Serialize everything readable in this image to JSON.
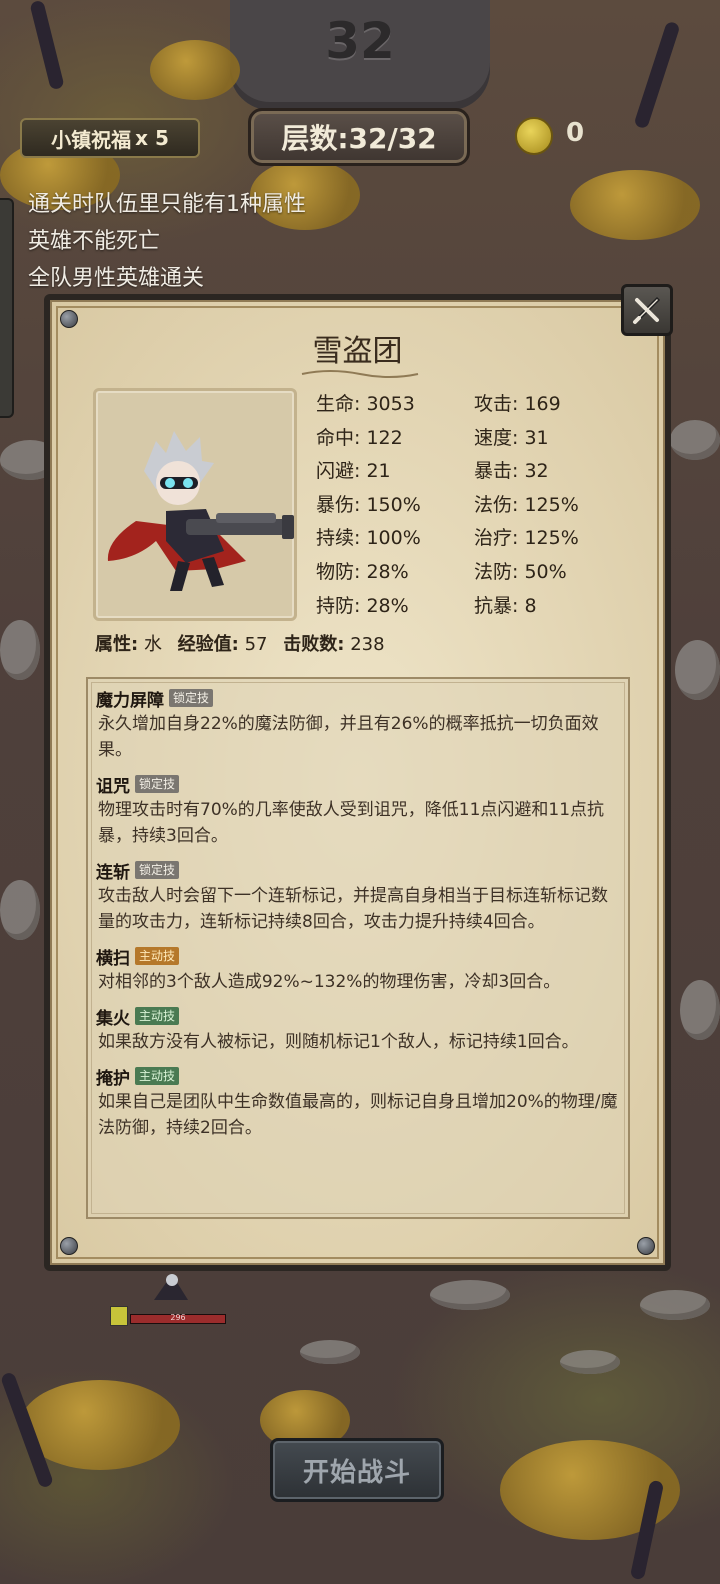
{
  "hud": {
    "wave_number": "32",
    "blessing_label": "小镇祝福",
    "blessing_count": "x 5",
    "floor_label": "层数:32/32",
    "coins": "0"
  },
  "objectives": [
    "通关时队伍里只能有1种属性",
    "英雄不能死亡",
    "全队男性英雄通关"
  ],
  "hero": {
    "name": "雪盗团",
    "stats": [
      "生命: 3053",
      "攻击: 169",
      "命中: 122",
      "速度: 31",
      "闪避: 21",
      "暴击: 32",
      "暴伤: 150%",
      "法伤: 125%",
      "持续: 100%",
      "治疗: 125%",
      "物防: 28%",
      "法防: 50%",
      "持防: 28%",
      "抗暴: 8"
    ],
    "attribute_label": "属性:",
    "attribute_value": "水",
    "exp_label": "经验值:",
    "exp_value": "57",
    "kills_label": "击败数:",
    "kills_value": "238"
  },
  "skills": [
    {
      "name": "魔力屏障",
      "tag": "锁定技",
      "tag_type": "locked",
      "desc": "永久增加自身22%的魔法防御，并且有26%的概率抵抗一切负面效果。"
    },
    {
      "name": "诅咒",
      "tag": "锁定技",
      "tag_type": "locked",
      "desc": "物理攻击时有70%的几率使敌人受到诅咒，降低11点闪避和11点抗暴，持续3回合。"
    },
    {
      "name": "连斩",
      "tag": "锁定技",
      "tag_type": "locked",
      "desc": "攻击敌人时会留下一个连斩标记，并提高自身相当于目标连斩标记数量的攻击力，连斩标记持续8回合，攻击力提升持续4回合。"
    },
    {
      "name": "横扫",
      "tag": "主动技",
      "tag_type": "active-o",
      "desc": "对相邻的3个敌人造成92%~132%的物理伤害，冷却3回合。"
    },
    {
      "name": "集火",
      "tag": "主动技",
      "tag_type": "active-g",
      "desc": "如果敌方没有人被标记，则随机标记1个敌人，标记持续1回合。"
    },
    {
      "name": "掩护",
      "tag": "主动技",
      "tag_type": "active-g",
      "desc": "如果自己是团队中生命数值最高的，则标记自身且增加20%的物理/魔法防御，持续2回合。"
    }
  ],
  "field": {
    "hp_value": "296"
  },
  "start_button": "开始战斗",
  "colors": {
    "panel_bg": "#e3d6b6",
    "panel_frame": "#2b2622",
    "tag_locked": "#7a7670",
    "tag_active_orange": "#b5782a",
    "tag_active_green": "#4a7a52"
  },
  "icons": [
    "coin-icon",
    "close-icon",
    "level-badge-icon"
  ]
}
